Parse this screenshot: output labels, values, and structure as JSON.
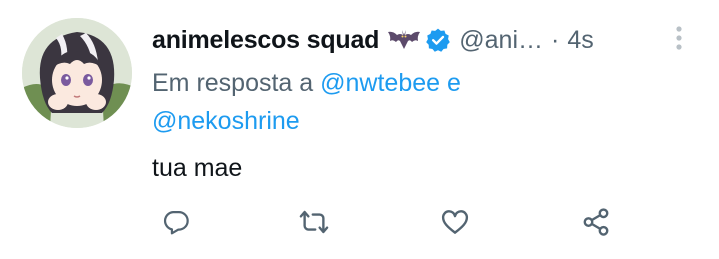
{
  "tweet": {
    "display_name": "animelescos squad",
    "name_emoji": "bat-emoji",
    "verified_badge": "verified-badge-icon",
    "handle": "@ani…",
    "separator": "·",
    "timestamp": "4s",
    "reply_context": {
      "prefix": "Em resposta a ",
      "mention_1": "@nwtebee",
      "conjunction": " e",
      "mention_2": "@nekoshrine"
    },
    "text": "tua mae"
  },
  "actions": [
    {
      "name": "reply",
      "icon": "reply-icon"
    },
    {
      "name": "retweet",
      "icon": "retweet-icon"
    },
    {
      "name": "like",
      "icon": "heart-icon"
    },
    {
      "name": "share",
      "icon": "share-icon"
    }
  ],
  "colors": {
    "text_primary": "#0f1419",
    "text_secondary": "#536471",
    "accent": "#1d9bf0"
  }
}
